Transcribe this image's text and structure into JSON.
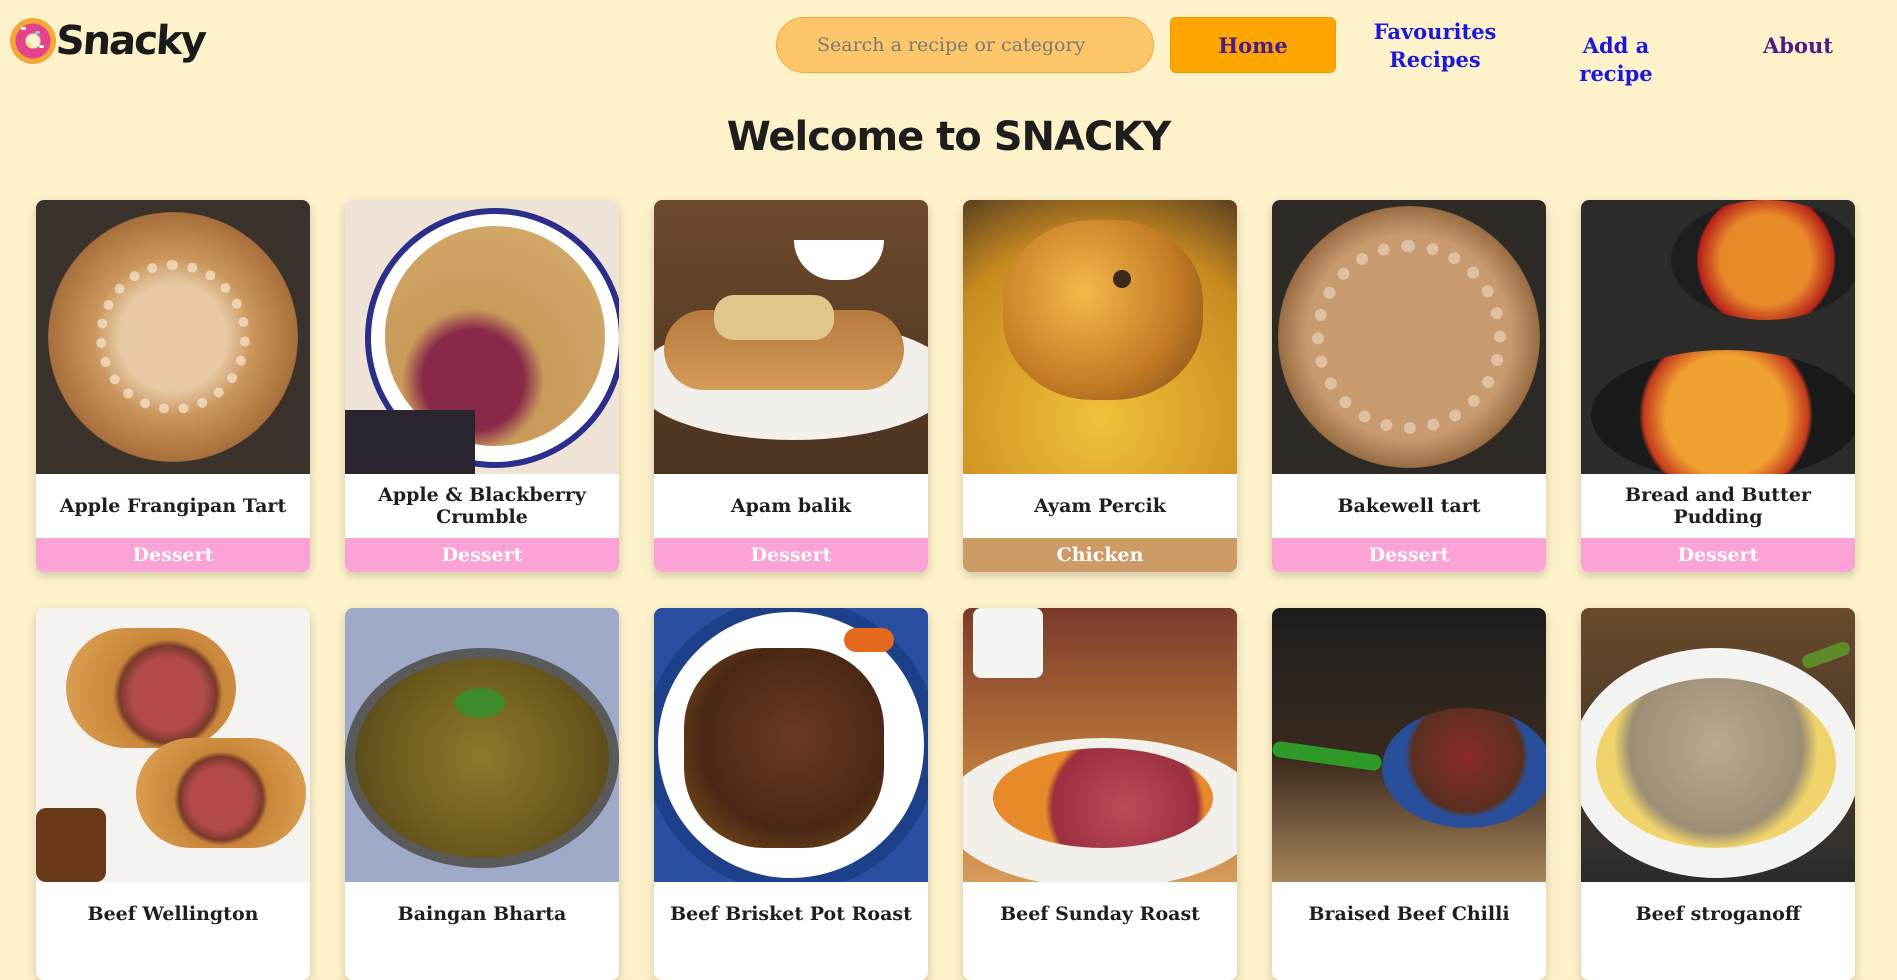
{
  "brand": {
    "name": "Snacky",
    "logo_icon": "donut-icon"
  },
  "search": {
    "placeholder": "Search a recipe or category"
  },
  "nav": {
    "home": "Home",
    "favourites_line1": "Favourites",
    "favourites_line2": "Recipes",
    "add": "Add a recipe",
    "about": "About"
  },
  "page": {
    "title": "Welcome to SNACKY"
  },
  "colors": {
    "background": "#fef2cb",
    "home_button": "#ffa500",
    "dessert": "#fca3d6",
    "chicken": "#cd9b66",
    "link": "#1a1ad6"
  },
  "recipes": [
    {
      "name": "Apple Frangipan Tart",
      "category": "Dessert"
    },
    {
      "name": "Apple & Blackberry Crumble",
      "category": "Dessert"
    },
    {
      "name": "Apam balik",
      "category": "Dessert"
    },
    {
      "name": "Ayam Percik",
      "category": "Chicken"
    },
    {
      "name": "Bakewell tart",
      "category": "Dessert"
    },
    {
      "name": "Bread and Butter Pudding",
      "category": "Dessert"
    },
    {
      "name": "Beef Wellington",
      "category": ""
    },
    {
      "name": "Baingan Bharta",
      "category": ""
    },
    {
      "name": "Beef Brisket Pot Roast",
      "category": ""
    },
    {
      "name": "Beef Sunday Roast",
      "category": ""
    },
    {
      "name": "Braised Beef Chilli",
      "category": ""
    },
    {
      "name": "Beef stroganoff",
      "category": ""
    }
  ]
}
